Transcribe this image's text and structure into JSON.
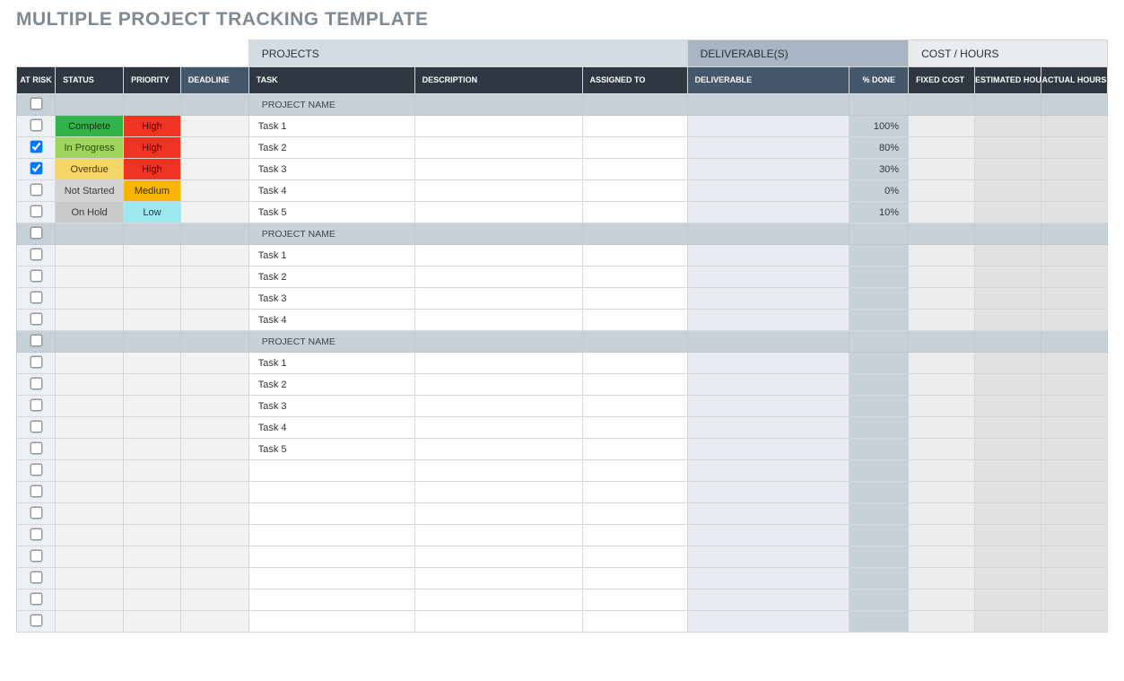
{
  "title": "MULTIPLE PROJECT TRACKING TEMPLATE",
  "groupHeaders": {
    "projects": "PROJECTS",
    "deliverables": "DELIVERABLE(S)",
    "cost": "COST / HOURS"
  },
  "columns": {
    "atRisk": "AT RISK",
    "status": "STATUS",
    "priority": "PRIORITY",
    "deadline": "DEADLINE",
    "task": "TASK",
    "description": "DESCRIPTION",
    "assignedTo": "ASSIGNED TO",
    "deliverable": "DELIVERABLE",
    "pctDone": "% DONE",
    "fixedCost": "FIXED COST",
    "estHours": "ESTIMATED HOURS",
    "actHours": "ACTUAL HOURS"
  },
  "statusColors": {
    "Complete": "status-complete",
    "In Progress": "status-inprogress",
    "Overdue": "status-overdue",
    "Not Started": "status-notstarted",
    "On Hold": "status-onhold"
  },
  "priorityColors": {
    "High": "prio-high",
    "Medium": "prio-medium",
    "Low": "prio-low"
  },
  "rows": [
    {
      "type": "project",
      "checked": false,
      "task": "PROJECT NAME"
    },
    {
      "type": "task",
      "checked": false,
      "status": "Complete",
      "priority": "High",
      "task": "Task 1",
      "pctDone": "100%"
    },
    {
      "type": "task",
      "checked": true,
      "status": "In Progress",
      "priority": "High",
      "task": "Task 2",
      "pctDone": "80%"
    },
    {
      "type": "task",
      "checked": true,
      "status": "Overdue",
      "priority": "High",
      "task": "Task 3",
      "pctDone": "30%"
    },
    {
      "type": "task",
      "checked": false,
      "status": "Not Started",
      "priority": "Medium",
      "task": "Task 4",
      "pctDone": "0%"
    },
    {
      "type": "task",
      "checked": false,
      "status": "On Hold",
      "priority": "Low",
      "task": "Task 5",
      "pctDone": "10%"
    },
    {
      "type": "project",
      "checked": false,
      "task": "PROJECT NAME"
    },
    {
      "type": "task",
      "checked": false,
      "task": "Task 1"
    },
    {
      "type": "task",
      "checked": false,
      "task": "Task 2"
    },
    {
      "type": "task",
      "checked": false,
      "task": "Task 3"
    },
    {
      "type": "task",
      "checked": false,
      "task": "Task 4"
    },
    {
      "type": "project",
      "checked": false,
      "task": "PROJECT NAME"
    },
    {
      "type": "task",
      "checked": false,
      "task": "Task 1"
    },
    {
      "type": "task",
      "checked": false,
      "task": "Task 2"
    },
    {
      "type": "task",
      "checked": false,
      "task": "Task 3"
    },
    {
      "type": "task",
      "checked": false,
      "task": "Task 4"
    },
    {
      "type": "task",
      "checked": false,
      "task": "Task 5"
    },
    {
      "type": "task",
      "checked": false
    },
    {
      "type": "task",
      "checked": false
    },
    {
      "type": "task",
      "checked": false
    },
    {
      "type": "task",
      "checked": false
    },
    {
      "type": "task",
      "checked": false
    },
    {
      "type": "task",
      "checked": false
    },
    {
      "type": "task",
      "checked": false
    },
    {
      "type": "task",
      "checked": false
    }
  ]
}
